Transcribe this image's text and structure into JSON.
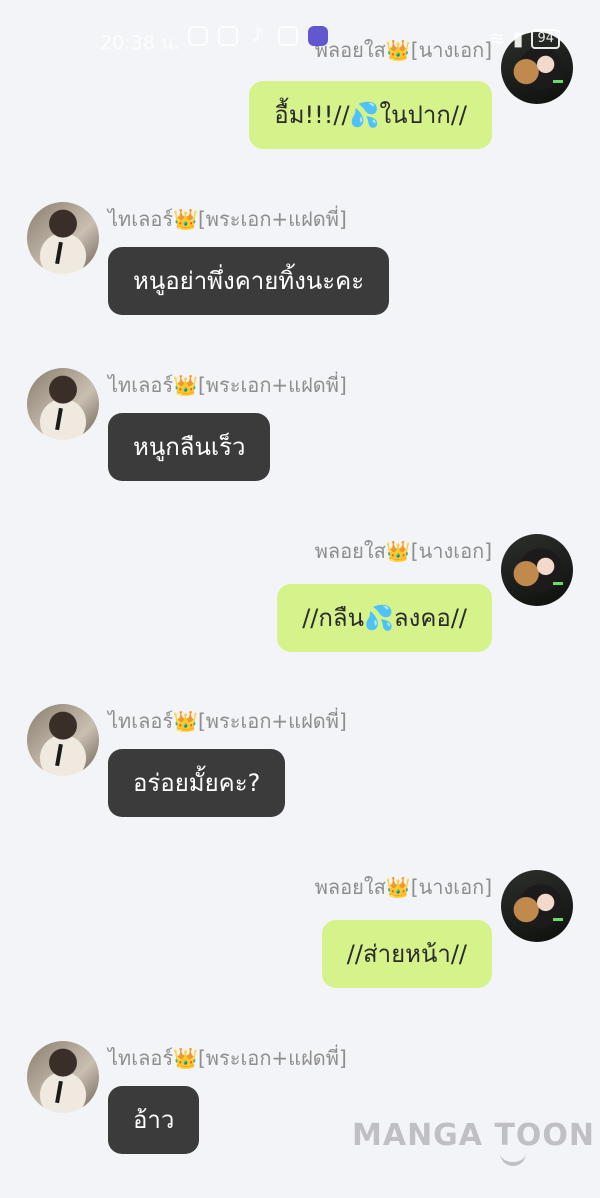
{
  "status_bar": {
    "time": "20:38 น.",
    "battery": "94"
  },
  "characters": {
    "female": {
      "name": "พลอยใส",
      "crown": "👑",
      "role": "[นางเอก]"
    },
    "male": {
      "name": "ไทเลอร์",
      "crown": "👑",
      "role": "[พระเอก+แฝดพี่]"
    }
  },
  "messages": [
    {
      "text_before": "อื้ม!!!//",
      "emoji": "💦",
      "text_after": "ในปาก//"
    },
    {
      "text": "หนูอย่าพึ่งคายทิ้งนะคะ"
    },
    {
      "text": "หนูกลืนเร็ว"
    },
    {
      "text_before": "//กลืน",
      "emoji": "💦",
      "text_after": "ลงคอ//"
    },
    {
      "text": "อร่อยมั้ยคะ?"
    },
    {
      "text": "//ส่ายหน้า//"
    },
    {
      "text": "อ้าว"
    }
  ],
  "watermark": "MANGA TOON"
}
